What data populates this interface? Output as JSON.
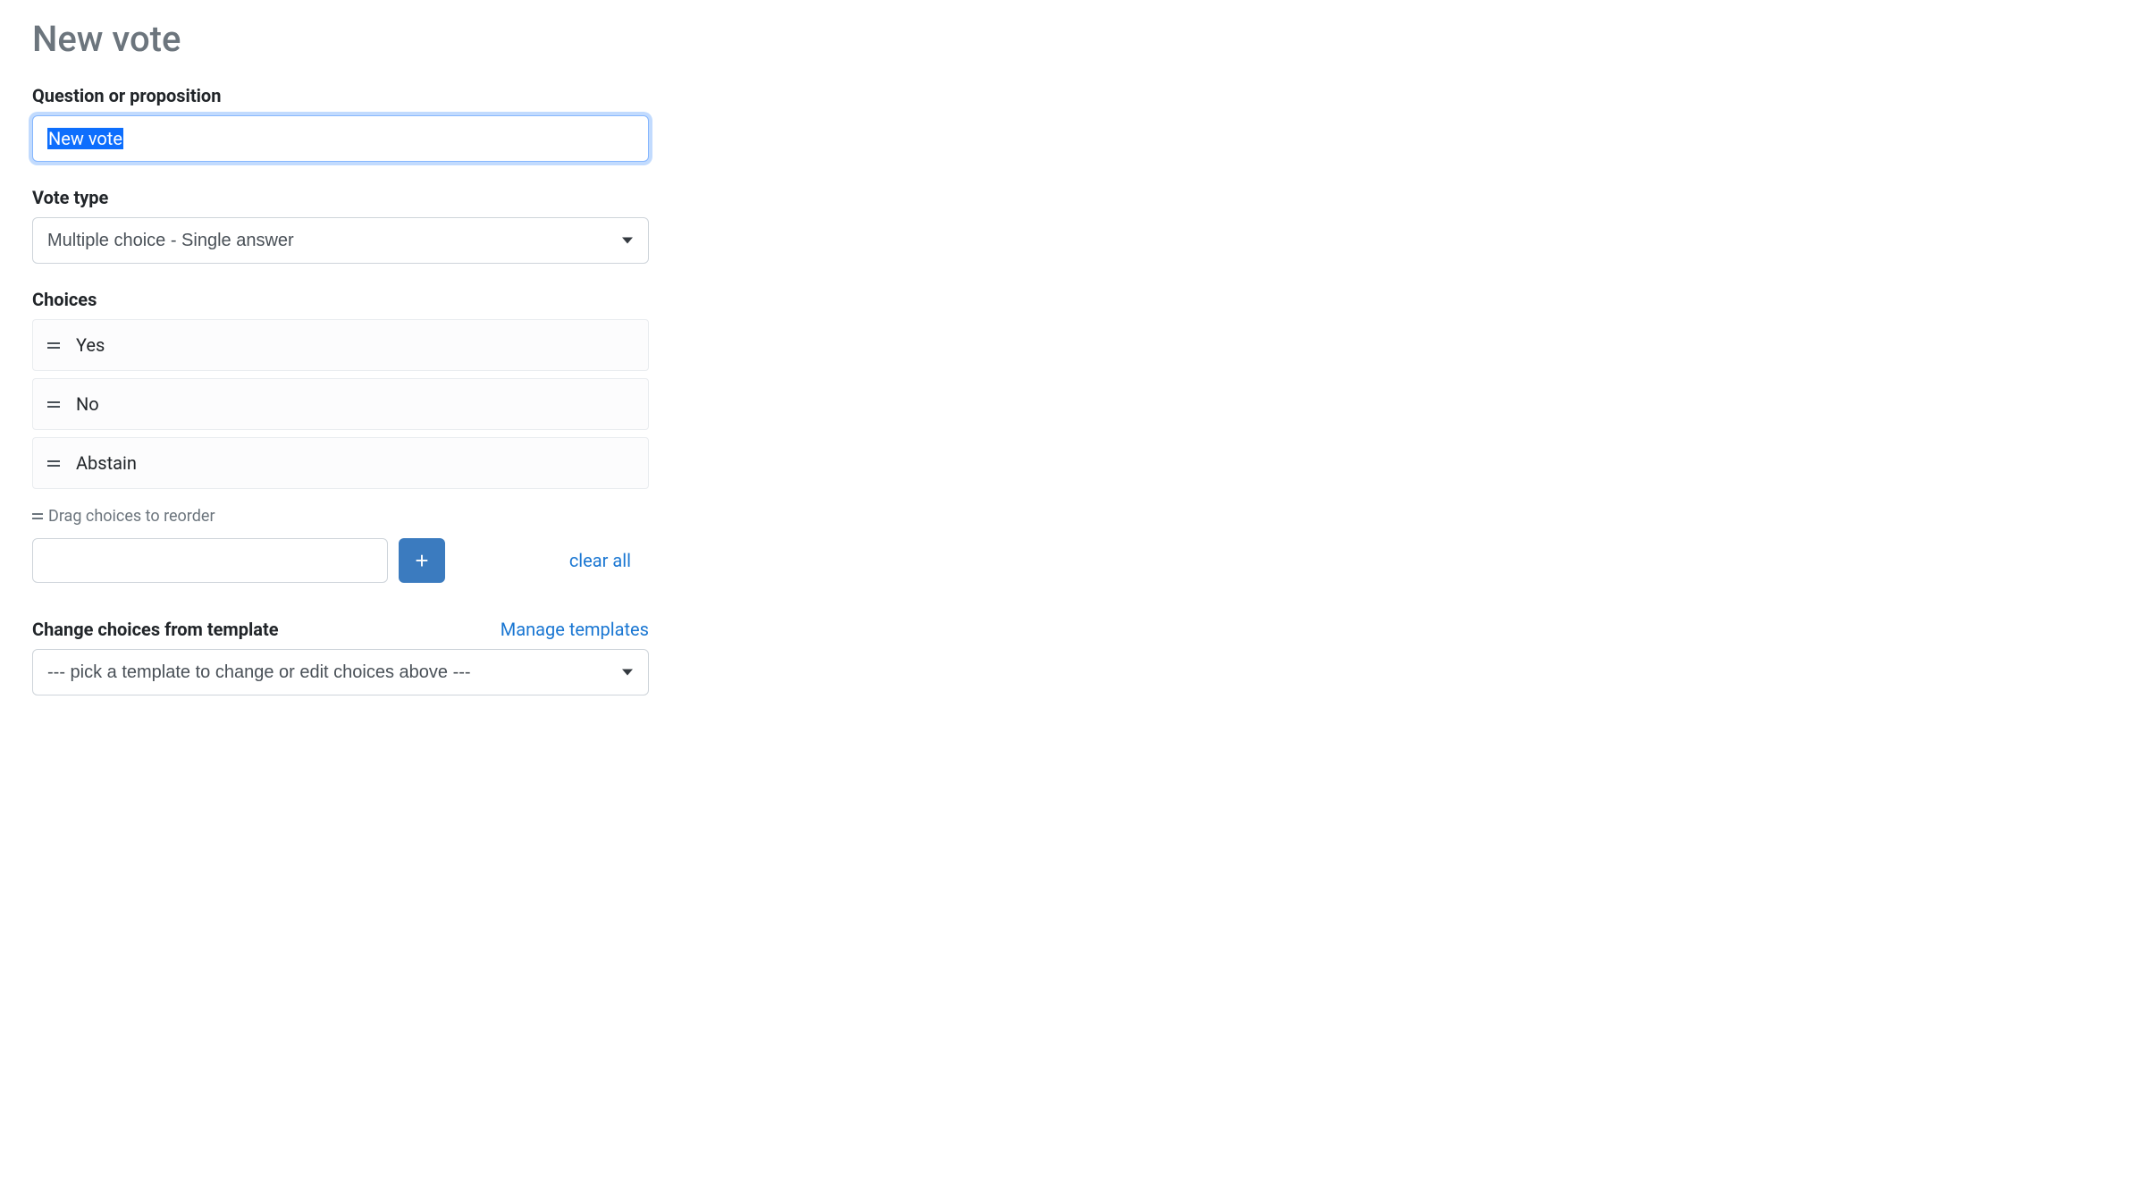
{
  "page_title": "New vote",
  "question": {
    "label": "Question or proposition",
    "value": "New vote"
  },
  "vote_type": {
    "label": "Vote type",
    "selected": "Multiple choice - Single answer"
  },
  "choices": {
    "label": "Choices",
    "items": [
      "Yes",
      "No",
      "Abstain"
    ],
    "hint": "Drag choices to reorder",
    "add_icon": "+",
    "clear_all": "clear all"
  },
  "template": {
    "label": "Change choices from template",
    "manage_link": "Manage templates",
    "placeholder": "--- pick a template to change or edit choices above ---"
  }
}
